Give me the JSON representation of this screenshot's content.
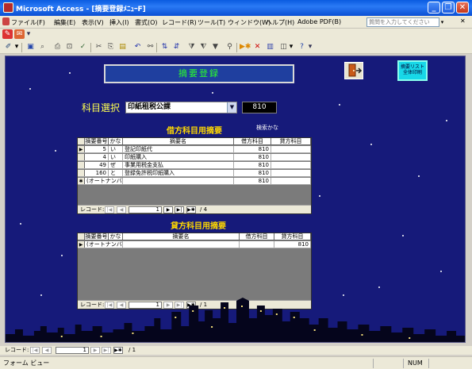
{
  "window": {
    "title": "Microsoft Access - [摘要登録ﾒﾆｭｰF]",
    "minimize": "_",
    "restore": "❐",
    "close": "✕"
  },
  "menu": {
    "items": [
      "ファイル(F)",
      "編集(E)",
      "表示(V)",
      "挿入(I)",
      "書式(O)",
      "レコード(R)",
      "ツール(T)",
      "ウィンドウ(W)",
      "ヘルプ(H)",
      "Adobe PDF(B)"
    ],
    "help_placeholder": "質問を入力してください",
    "help_close": "✕"
  },
  "form": {
    "header_title": "摘要登録",
    "top_right_button": "摘要リスト 全体印刷",
    "kamoku_label": "科目選択",
    "kamoku_value": "印紙租税公課",
    "kamoku_code": "810",
    "debit_title": "借方科目用摘要",
    "search_kana": "検索かな",
    "credit_title": "貸方科目用摘要"
  },
  "debit_table": {
    "columns": [
      "摘要番号",
      "かな",
      "摘要名",
      "借方科目",
      "貸方科目"
    ],
    "rows": [
      {
        "marker": "▶",
        "no": "5",
        "kana": "い",
        "name": "登記印紙代",
        "debit": "810",
        "credit": ""
      },
      {
        "marker": "",
        "no": "4",
        "kana": "い",
        "name": "印紙購入",
        "debit": "810",
        "credit": ""
      },
      {
        "marker": "",
        "no": "49",
        "kana": "ぜ",
        "name": "事業用税金支払",
        "debit": "810",
        "credit": ""
      },
      {
        "marker": "",
        "no": "160",
        "kana": "と",
        "name": "登録免許税印紙購入",
        "debit": "810",
        "credit": ""
      },
      {
        "marker": "✱",
        "no": "(オートナンバー)",
        "kana": "",
        "name": "",
        "debit": "810",
        "credit": ""
      }
    ],
    "nav_label": "レコード:",
    "current": "1",
    "total": "/ 4"
  },
  "credit_table": {
    "columns": [
      "摘要番号",
      "かな",
      "摘要名",
      "借方科目",
      "貸方科目"
    ],
    "rows": [
      {
        "marker": "▶",
        "no": "(オートナンバー)",
        "kana": "",
        "name": "",
        "debit": "",
        "credit": "810"
      }
    ],
    "nav_label": "レコード:",
    "current": "1",
    "total": "/ 1"
  },
  "outer_nav": {
    "label": "レコード:",
    "current": "1",
    "total": "/ 1"
  },
  "status": {
    "mode": "フォーム ビュー",
    "num": "NUM"
  }
}
